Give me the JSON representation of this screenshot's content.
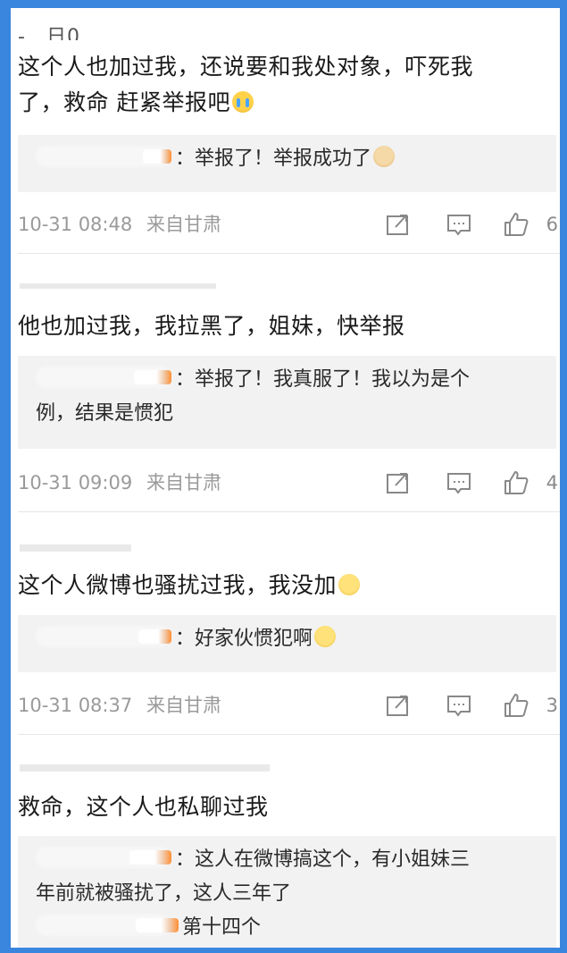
{
  "colors": {
    "frame": "#3a86df",
    "meta": "#9a9a9a",
    "reply_bg": "#f2f2f2"
  },
  "comments": [
    {
      "name": "-…日0",
      "text_line1": "这个人也加过我，还说要和我处对象，吓死我",
      "text_line2": "了，救命 赶紧举报吧",
      "emoji": "crying-face-emoji",
      "reply_name": "（已隐藏）",
      "reply_text": "：举报了！举报成功了",
      "reply_emoji": "doge-emoji",
      "time": "10-31 08:48",
      "source": "来自甘肃",
      "likes": "6"
    },
    {
      "name": "（已隐藏）",
      "text_line1": "他也加过我，我拉黑了，姐妹，快举报",
      "reply_name": "（已隐藏）",
      "reply_text_line1": "：举报了！我真服了！我以为是个",
      "reply_text_line2": "例，结果是惯犯",
      "time": "10-31 09:09",
      "source": "来自甘肃",
      "likes": "4"
    },
    {
      "name": "（已隐藏）",
      "text_line1": "这个人微博也骚扰过我，我没加",
      "emoji": "smile-emoji",
      "reply_name": "（已隐藏）",
      "reply_text": "：好家伙惯犯啊",
      "reply_emoji": "smile-emoji",
      "time": "10-31 08:37",
      "source": "来自甘肃",
      "likes": "3"
    },
    {
      "name": "（已隐藏）",
      "text_line1": "救命，这个人也私聊过我",
      "reply_name": "（已隐藏）",
      "reply_text_line1": "：这人在微博搞这个，有小姐妹三",
      "reply_text_line2": "年前就被骚扰了，这人三年了",
      "reply2_name": "（已隐藏）",
      "reply2_text": "第十四个"
    }
  ]
}
